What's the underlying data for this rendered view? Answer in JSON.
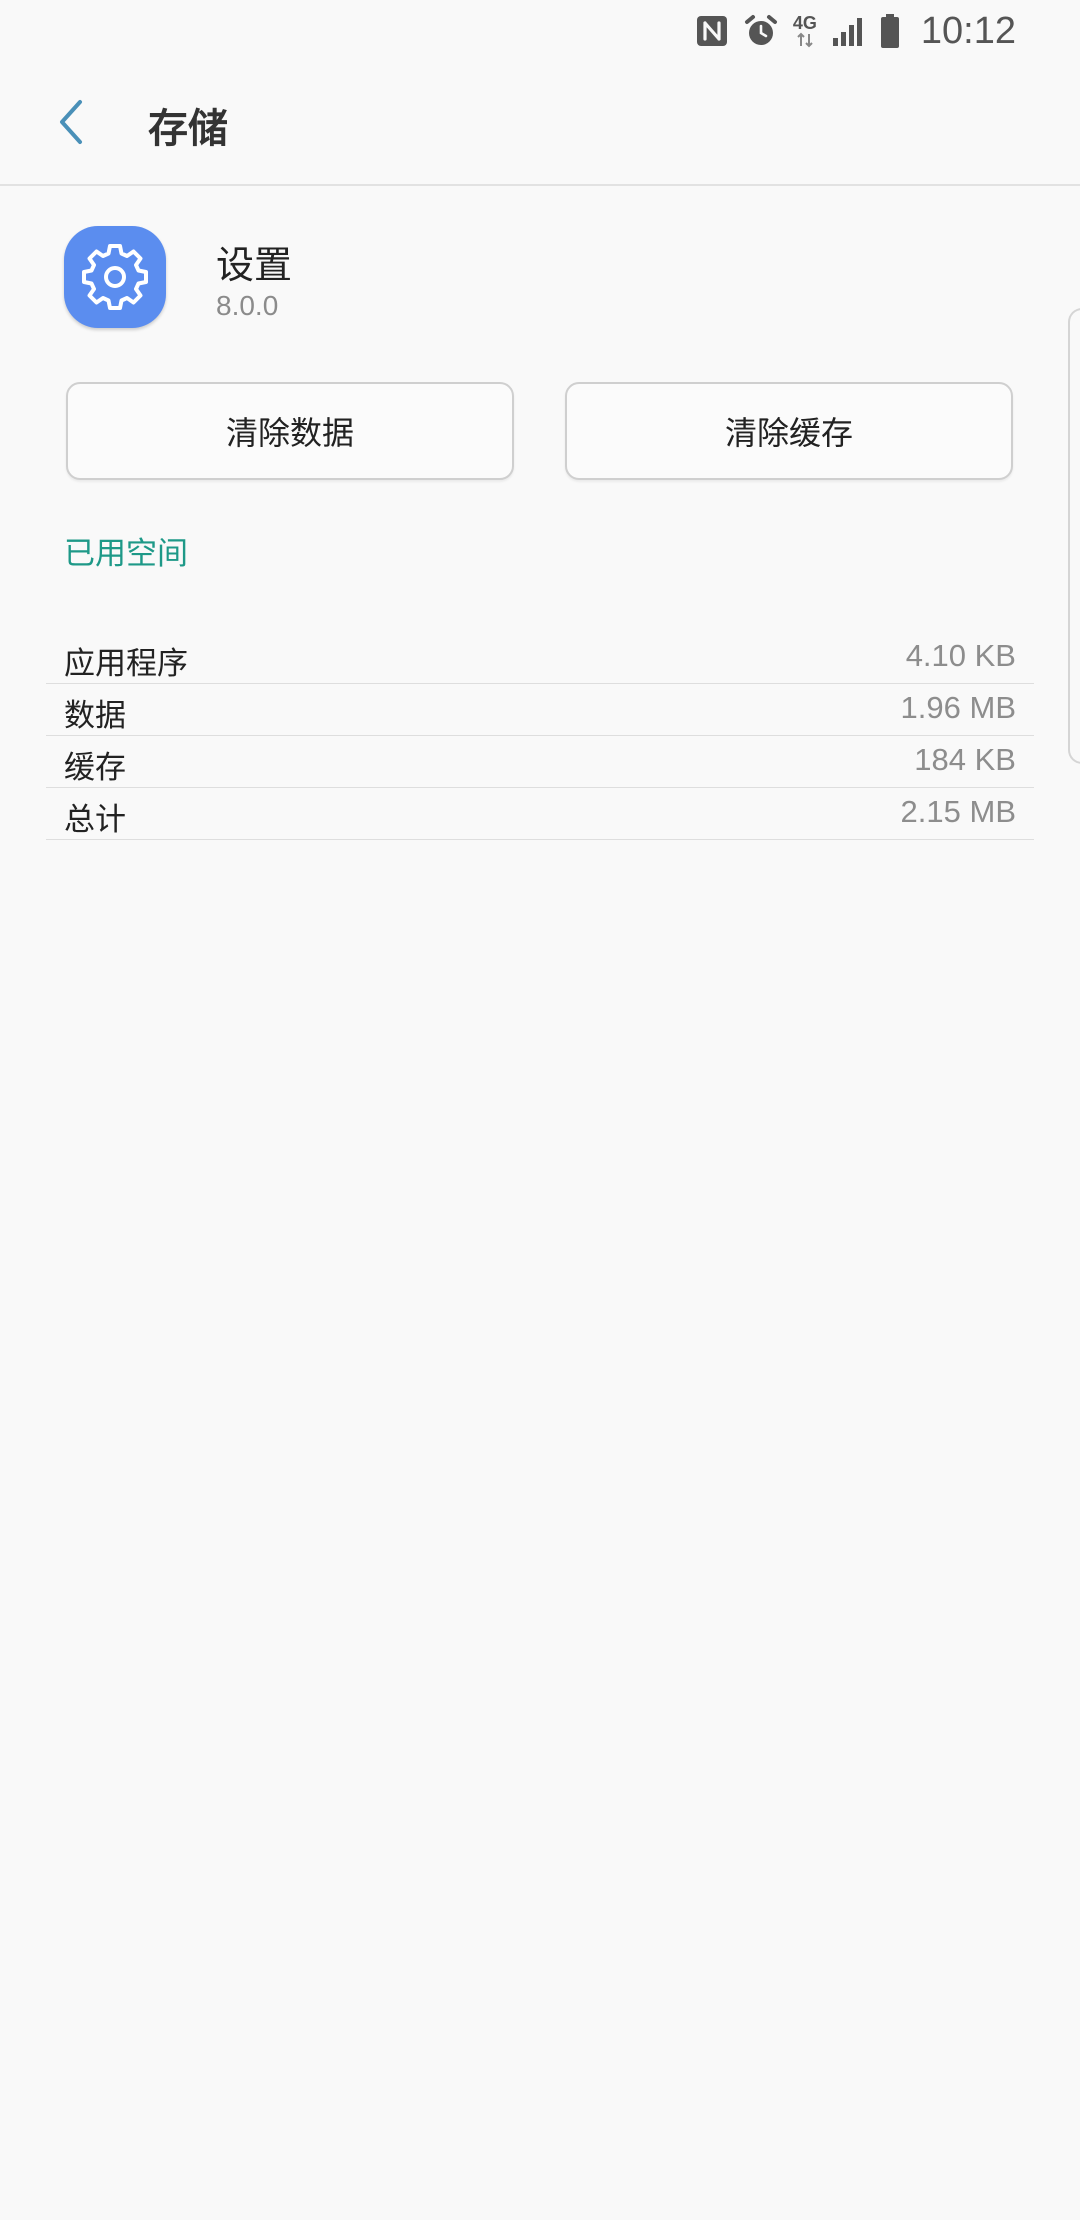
{
  "status_bar": {
    "icons": [
      "nfc-icon",
      "alarm-icon",
      "4g-network-icon",
      "signal-icon",
      "battery-icon"
    ],
    "network_label": "4G",
    "time": "10:12"
  },
  "header": {
    "title": "存储",
    "back_icon": "chevron-left-icon",
    "accent_color": "#4a90b8"
  },
  "app": {
    "name": "设置",
    "version": "8.0.0",
    "icon": "gear-icon",
    "icon_color": "#5b8def"
  },
  "actions": {
    "clear_data": "清除数据",
    "clear_cache": "清除缓存"
  },
  "section": {
    "title": "已用空间",
    "color": "#1e9988"
  },
  "storage": [
    {
      "label": "应用程序",
      "value": "4.10 KB"
    },
    {
      "label": "数据",
      "value": "1.96 MB"
    },
    {
      "label": "缓存",
      "value": "184 KB"
    },
    {
      "label": "总计",
      "value": "2.15 MB"
    }
  ]
}
